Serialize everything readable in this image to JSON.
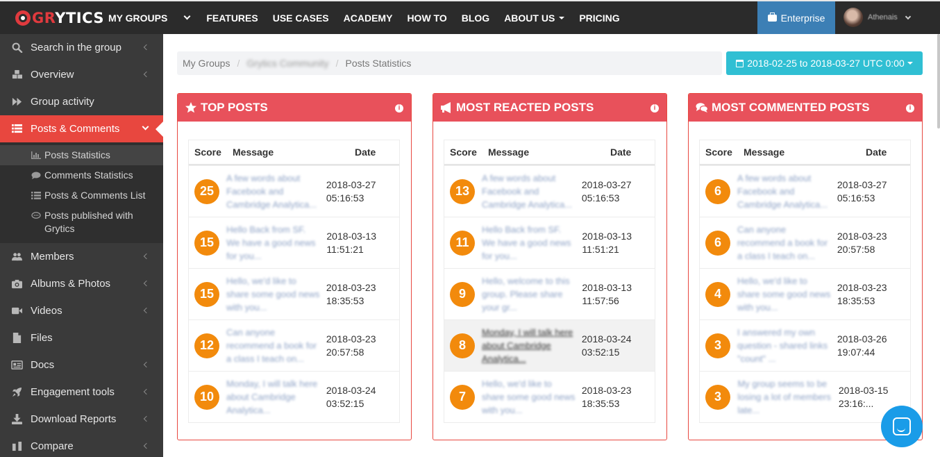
{
  "topbar": {
    "logo": {
      "gr": "GR",
      "ytics": "YTICS"
    },
    "nav": [
      {
        "label": "MY GROUPS",
        "has_chevron": true
      },
      {
        "label": "FEATURES"
      },
      {
        "label": "USE CASES"
      },
      {
        "label": "ACADEMY"
      },
      {
        "label": "HOW TO"
      },
      {
        "label": "BLOG"
      },
      {
        "label": "ABOUT US",
        "has_caret": true
      },
      {
        "label": "PRICING"
      }
    ],
    "enterprise_label": "Enterprise",
    "user_name": "Athenais",
    "colors": {
      "bg": "#2b2b2b",
      "enterprise": "#3c7fb5",
      "logo_red": "#e03a3e"
    }
  },
  "sidebar": {
    "items": [
      {
        "label": "Search in the group",
        "icon": "search-icon",
        "chevron": true
      },
      {
        "label": "Overview",
        "icon": "cubes-icon",
        "chevron": true
      },
      {
        "label": "Group activity",
        "icon": "fast-forward-icon",
        "chevron": false
      },
      {
        "label": "Posts & Comments",
        "icon": "list-icon",
        "active": true
      }
    ],
    "submenu": [
      {
        "label": "Posts Statistics",
        "icon": "bar-chart-icon",
        "current": true
      },
      {
        "label": "Comments Statistics",
        "icon": "comment-icon"
      },
      {
        "label": "Posts & Comments List",
        "icon": "list-icon"
      },
      {
        "label": "Posts published with Grytics",
        "icon": "comment-dots-icon"
      }
    ],
    "items_after": [
      {
        "label": "Members",
        "icon": "users-icon",
        "chevron": true
      },
      {
        "label": "Albums & Photos",
        "icon": "camera-icon",
        "chevron": true
      },
      {
        "label": "Videos",
        "icon": "video-camera-icon",
        "chevron": true
      },
      {
        "label": "Files",
        "icon": "file-icon",
        "chevron": false
      },
      {
        "label": "Docs",
        "icon": "doc-icon",
        "chevron": true
      },
      {
        "label": "Engagement tools",
        "icon": "rocket-icon",
        "chevron": true
      },
      {
        "label": "Download Reports",
        "icon": "download-icon",
        "chevron": true
      },
      {
        "label": "Compare",
        "icon": "compare-icon",
        "chevron": true
      }
    ],
    "colors": {
      "bg": "#3a3a3a",
      "active": "#e8473f"
    }
  },
  "breadcrumb": [
    "My Groups",
    "Grytics Community",
    "Posts Statistics"
  ],
  "date_range": "2018-02-25 to 2018-03-27 UTC 0:00",
  "table_headers": {
    "score": "Score",
    "message": "Message",
    "date": "Date"
  },
  "panels": [
    {
      "title": "TOP POSTS",
      "icon": "star-icon",
      "rows": [
        {
          "score": "25",
          "message": "A few words about Facebook and Cambridge Analytica...",
          "date": "2018-03-27 05:16:53"
        },
        {
          "score": "15",
          "message": "Hello Back from SF. We have a good news for you...",
          "date": "2018-03-13 11:51:21"
        },
        {
          "score": "15",
          "message": "Hello, we'd like to share some good news with you...",
          "date": "2018-03-23 18:35:53"
        },
        {
          "score": "12",
          "message": "Can anyone recommend a book for a class I teach on...",
          "date": "2018-03-23 20:57:58"
        },
        {
          "score": "10",
          "message": "Monday, I will talk here about Cambridge Analytica...",
          "date": "2018-03-24 03:52:15"
        }
      ]
    },
    {
      "title": "MOST REACTED POSTS",
      "icon": "bullhorn-icon",
      "rows": [
        {
          "score": "13",
          "message": "A few words about Facebook and Cambridge Analytica...",
          "date": "2018-03-27 05:16:53"
        },
        {
          "score": "11",
          "message": "Hello Back from SF. We have a good news for you...",
          "date": "2018-03-13 11:51:21"
        },
        {
          "score": "9",
          "message": "Hello, welcome to this group. Please share your gr...",
          "date": "2018-03-13 11:57:56"
        },
        {
          "score": "8",
          "message": "Monday, I will talk here about Cambridge Analytica...",
          "date": "2018-03-24 03:52:15",
          "highlight": true
        },
        {
          "score": "7",
          "message": "Hello, we'd like to share some good news with you...",
          "date": "2018-03-23 18:35:53"
        }
      ]
    },
    {
      "title": "MOST COMMENTED POSTS",
      "icon": "comments-icon",
      "rows": [
        {
          "score": "6",
          "message": "A few words about Facebook and Cambridge Analytica...",
          "date": "2018-03-27 05:16:53"
        },
        {
          "score": "6",
          "message": "Can anyone recommend a book for a class I teach on...",
          "date": "2018-03-23 20:57:58"
        },
        {
          "score": "4",
          "message": "Hello, we'd like to share some good news with you...",
          "date": "2018-03-23 18:35:53"
        },
        {
          "score": "3",
          "message": "I answered my own question - shared links \"count\" ...",
          "date": "2018-03-26 19:07:44"
        },
        {
          "score": "3",
          "message": "My group seems to be losing a lot of members late...",
          "date": "2018-03-15 23:16:..."
        }
      ]
    }
  ],
  "colors": {
    "panel_header": "#e8515b",
    "score_badge": "#f28a0c",
    "date_button": "#30bfd3",
    "chat": "#1a9ce8"
  }
}
